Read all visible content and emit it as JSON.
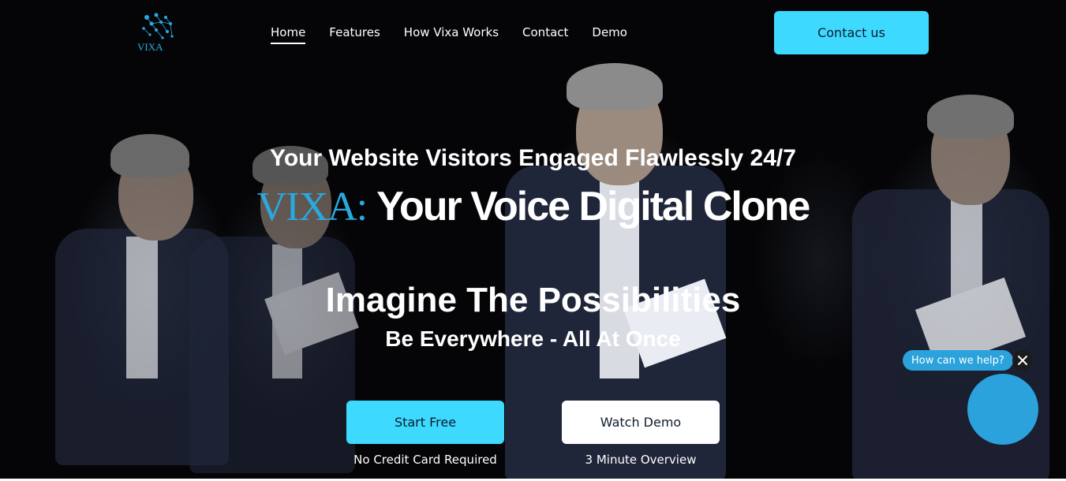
{
  "logo": {
    "text": "VIXA",
    "icon": "vixa-logo-icon",
    "color": "#29a9e0"
  },
  "nav": {
    "links": [
      "Home",
      "Features",
      "How Vixa Works",
      "Contact",
      "Demo"
    ],
    "active": "Home",
    "contact_label": "Contact us"
  },
  "hero": {
    "headline": "Your Website Visitors Engaged Flawlessly 24/7",
    "brand": "VIXA:",
    "title_rest": "Your Voice Digital Clone",
    "imagine": "Imagine The Possibilities",
    "everywhere": "Be Everywhere - All At Once",
    "start_label": "Start Free",
    "start_note": "No Credit Card Required",
    "watch_label": "Watch Demo",
    "watch_note": "3 Minute Overview"
  },
  "chat": {
    "prompt": "How can we help?",
    "close_icon": "close-icon",
    "launcher_icon": "chat-launcher-icon"
  },
  "colors": {
    "accent": "#3ed9ff",
    "brand_blue": "#29a9e0",
    "chat_blue": "#2ba2dc",
    "background": "#000000"
  }
}
